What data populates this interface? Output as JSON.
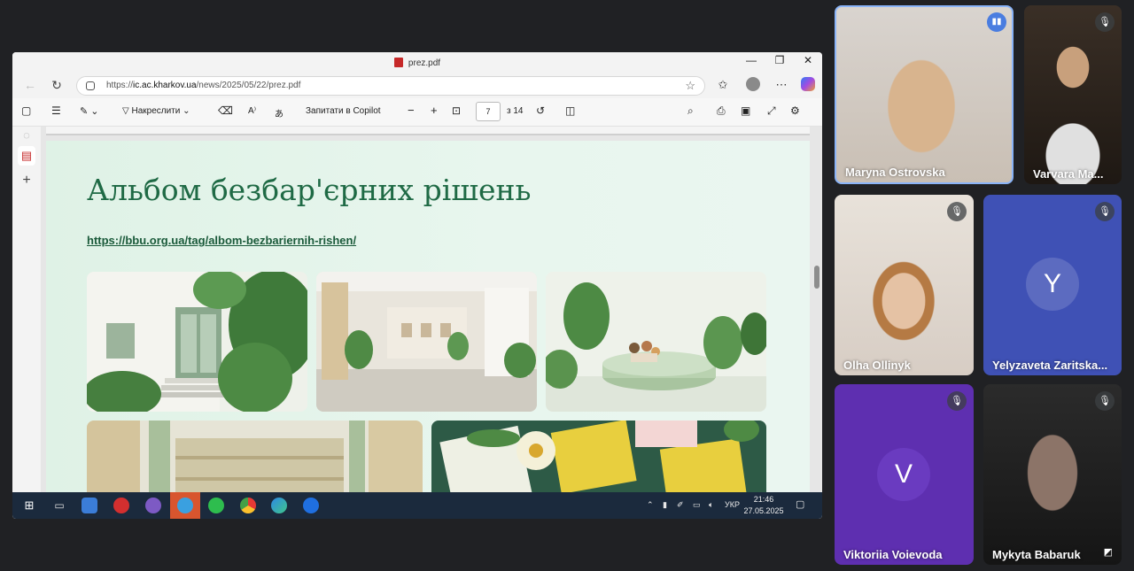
{
  "browser": {
    "tab_title": "prez.pdf",
    "url_prefix": "https://",
    "url_domain": "ic.ac.kharkov.ua",
    "url_path": "/news/2025/05/22/prez.pdf",
    "window_controls": {
      "minimize": "—",
      "restore": "❐",
      "close": "✕"
    }
  },
  "pdf_toolbar": {
    "draw_label": "Накреслити",
    "copilot_label": "Запитати в Copilot",
    "current_page": "7",
    "total_pages_label": "з 14",
    "zoom_minus": "−",
    "zoom_plus": "+"
  },
  "slide": {
    "title": "Альбом безбар'єрних рішень",
    "link": "https://bbu.org.ua/tag/albom-bezbariernih-rishen/"
  },
  "taskbar": {
    "language": "УКР",
    "time": "21:46",
    "date": "27.05.2025"
  },
  "participants": [
    {
      "name": "Maryna Ostrovska",
      "speaking": true
    },
    {
      "name": "Varvara Ma..."
    },
    {
      "name": "Olha Ollinyk"
    },
    {
      "name": "Yelyzaveta Zaritska...",
      "avatar_letter": "Y"
    },
    {
      "name": "Viktoriia Voievoda",
      "avatar_letter": "V"
    },
    {
      "name": "Mykyta Babaruk"
    }
  ],
  "colors": {
    "slide_title": "#1f6a45",
    "accent_blue_tile": "#3f51b5",
    "accent_purple_tile": "#5e2fb0",
    "speaking_border": "#8ab4f8"
  }
}
